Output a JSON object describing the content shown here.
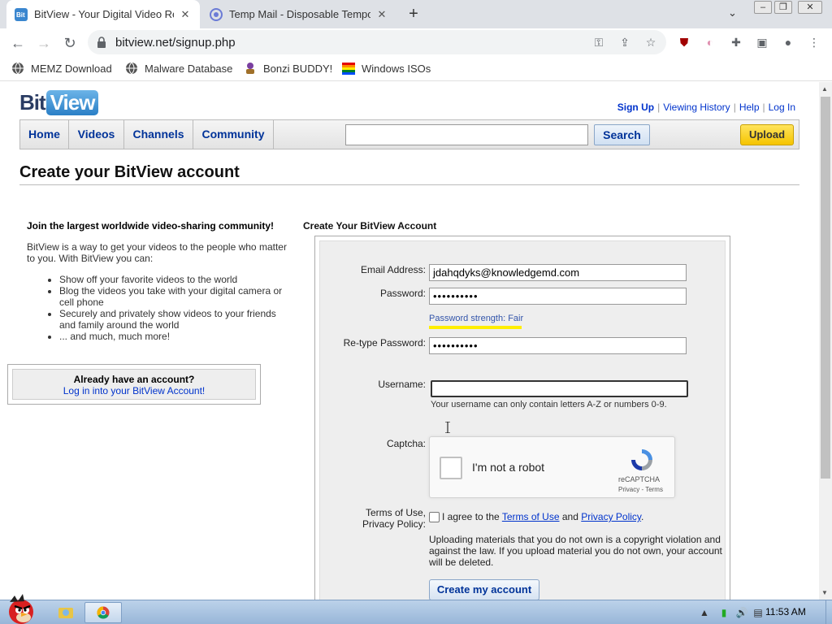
{
  "browser": {
    "tabs": [
      {
        "title": "BitView - Your Digital Video Re",
        "active": true,
        "favicon": "bitview-favicon"
      },
      {
        "title": "Temp Mail - Disposable Tempo",
        "active": false,
        "favicon": "tempmail-favicon"
      }
    ],
    "new_tab": "+",
    "url": "bitview.net/signup.php",
    "bookmarks": [
      {
        "label": "MEMZ Download",
        "icon": "globe-icon"
      },
      {
        "label": "Malware Database",
        "icon": "globe-icon"
      },
      {
        "label": "Bonzi BUDDY!",
        "icon": "bonzi-icon"
      },
      {
        "label": "Windows ISOs",
        "icon": "windows-flag-icon"
      }
    ]
  },
  "site": {
    "logo_bit": "Bit",
    "logo_view": "View",
    "top_links": {
      "signup": "Sign Up",
      "history": "Viewing History",
      "help": "Help",
      "login": "Log In"
    },
    "nav": {
      "home": "Home",
      "videos": "Videos",
      "channels": "Channels",
      "community": "Community"
    },
    "search_button": "Search",
    "upload_button": "Upload"
  },
  "page": {
    "title": "Create your BitView account",
    "left": {
      "heading": "Join the largest worldwide video-sharing community!",
      "intro": "BitView is a way to get your videos to the people who matter to you. With BitView you can:",
      "bullets": [
        "Show off your favorite videos to the world",
        "Blog the videos you take with your digital camera or cell phone",
        "Securely and privately show videos to your friends and family around the world",
        "... and much, much more!"
      ],
      "login_question": "Already have an account?",
      "login_link": "Log in into your BitView Account!"
    },
    "form": {
      "heading": "Create Your BitView Account",
      "email_label": "Email Address:",
      "email_value": "jdahqdyks@knowledgemd.com",
      "password_label": "Password:",
      "password_value": "••••••••••",
      "strength_text": "Password strength: Fair",
      "strength_fraction": 0.36,
      "retype_label": "Re-type Password:",
      "retype_value": "••••••••••",
      "username_label": "Username:",
      "username_value": "",
      "username_hint": "Your username can only contain letters A-Z or numbers 0-9.",
      "captcha_label": "Captcha:",
      "captcha_text": "I'm not a robot",
      "captcha_brand": "reCAPTCHA",
      "captcha_links": "Privacy - Terms",
      "tos_label_line1": "Terms of Use,",
      "tos_label_line2": "Privacy Policy:",
      "tos_prefix": "I agree to the",
      "tos_link": "Terms of Use",
      "tos_and": "and",
      "privacy_link": "Privacy Policy",
      "tos_end": ".",
      "legal_text": "Uploading materials that you do not own is a copyright violation and against the law. If you upload material you do not own, your account will be deleted.",
      "submit": "Create my account"
    }
  },
  "taskbar": {
    "clock": "11:53 AM"
  },
  "colors": {
    "link": "#0033cc",
    "nav_text": "#003399",
    "upload_yellow": "#f5c400",
    "strength_bar": "#ffee00"
  }
}
